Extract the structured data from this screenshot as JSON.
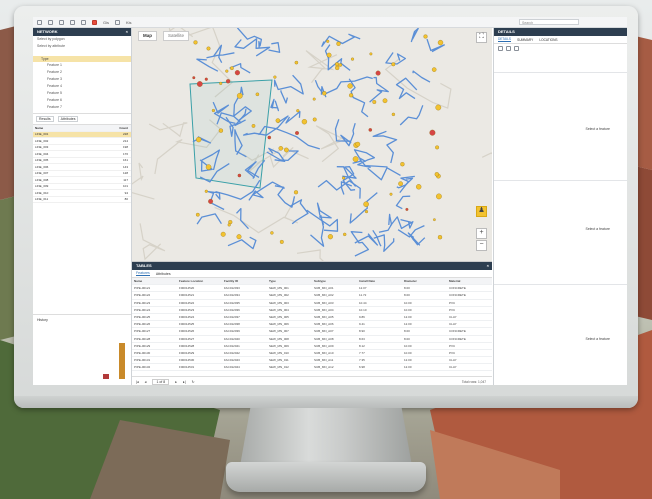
{
  "toolbar": {
    "items": [
      "Gis",
      "Kis"
    ],
    "search_placeholder": "Search"
  },
  "left_panel": {
    "title": "NETWORK",
    "lines": [
      "Select by polygon",
      "Select by attribute"
    ],
    "group_header": "Type",
    "group_items": [
      "Feature 1",
      "Feature 2",
      "Feature 3",
      "Feature 4",
      "Feature 5",
      "Feature 6",
      "Feature 7"
    ],
    "tabs": [
      "Results",
      "Attributes"
    ],
    "table_header": [
      "Name",
      "Count"
    ],
    "table_rows": [
      [
        "LINE_001",
        "228"
      ],
      [
        "LINE_002",
        "214"
      ],
      [
        "LINE_003",
        "198"
      ],
      [
        "LINE_004",
        "176"
      ],
      [
        "LINE_005",
        "161"
      ],
      [
        "LINE_006",
        "143"
      ],
      [
        "LINE_007",
        "128"
      ],
      [
        "LINE_008",
        "117"
      ],
      [
        "LINE_009",
        "101"
      ],
      [
        "LINE_010",
        "94"
      ],
      [
        "LINE_011",
        "80"
      ]
    ],
    "chart_title": "History"
  },
  "map": {
    "tab_map": "Map",
    "tab_satellite": "Satellite"
  },
  "tables": {
    "title": "TABLES",
    "subtabs": [
      "Features",
      "Attributes"
    ],
    "columns": [
      "Name",
      "Feature Location",
      "Facility ID",
      "Type",
      "Subtype",
      "Install Date",
      "Diameter",
      "Material"
    ],
    "rows": [
      [
        "PIPE-00121",
        "F00014520",
        "FAC012033",
        "SEW_MN_001",
        "SUB_MN_A01",
        "12.07",
        "8.00",
        "CONCRETE"
      ],
      [
        "PIPE-00122",
        "F00014521",
        "FAC012034",
        "SEW_MN_002",
        "SUB_MN_A02",
        "11.72",
        "8.00",
        "CONCRETE"
      ],
      [
        "PIPE-00123",
        "F00014522",
        "FAC012035",
        "SEW_MN_003",
        "SUB_MN_A03",
        "10.44",
        "10.00",
        "PVC"
      ],
      [
        "PIPE-00124",
        "F00014523",
        "FAC012036",
        "SEW_MN_004",
        "SUB_MN_A04",
        "10.10",
        "10.00",
        "PVC"
      ],
      [
        "PIPE-00125",
        "F00014524",
        "FAC012037",
        "SEW_MN_005",
        "SUB_MN_A05",
        "9.86",
        "12.00",
        "CLAY"
      ],
      [
        "PIPE-00126",
        "F00014525",
        "FAC012038",
        "SEW_MN_006",
        "SUB_MN_A06",
        "9.41",
        "12.00",
        "CLAY"
      ],
      [
        "PIPE-00127",
        "F00014526",
        "FAC012039",
        "SEW_MN_007",
        "SUB_MN_A07",
        "8.90",
        "8.00",
        "CONCRETE"
      ],
      [
        "PIPE-00128",
        "F00014527",
        "FAC012040",
        "SEW_MN_008",
        "SUB_MN_A08",
        "8.63",
        "8.00",
        "CONCRETE"
      ],
      [
        "PIPE-00129",
        "F00014528",
        "FAC012041",
        "SEW_MN_009",
        "SUB_MN_A09",
        "8.12",
        "10.00",
        "PVC"
      ],
      [
        "PIPE-00130",
        "F00014529",
        "FAC012042",
        "SEW_MN_010",
        "SUB_MN_A10",
        "7.77",
        "10.00",
        "PVC"
      ],
      [
        "PIPE-00131",
        "F00014530",
        "FAC012043",
        "SEW_MN_011",
        "SUB_MN_A11",
        "7.35",
        "12.00",
        "CLAY"
      ],
      [
        "PIPE-00132",
        "F00014531",
        "FAC012044",
        "SEW_MN_012",
        "SUB_MN_A12",
        "6.98",
        "12.00",
        "CLAY"
      ]
    ],
    "page_label": "1 of 8",
    "row_count": "Total rows: 1,047"
  },
  "right_panel": {
    "title": "DETAILS",
    "tabs": [
      "DETAILS",
      "SUMMARY",
      "LOCATIONS"
    ],
    "sections": [
      "Select a feature",
      "Select a feature",
      "Select a feature"
    ]
  },
  "colors": {
    "panel_header": "#2d3e50",
    "accent": "#2d6fb3",
    "selection": "#f6e3a7",
    "pipe": "#5b8fd6",
    "marker_yellow": "#f2c230",
    "marker_red": "#d64545"
  }
}
